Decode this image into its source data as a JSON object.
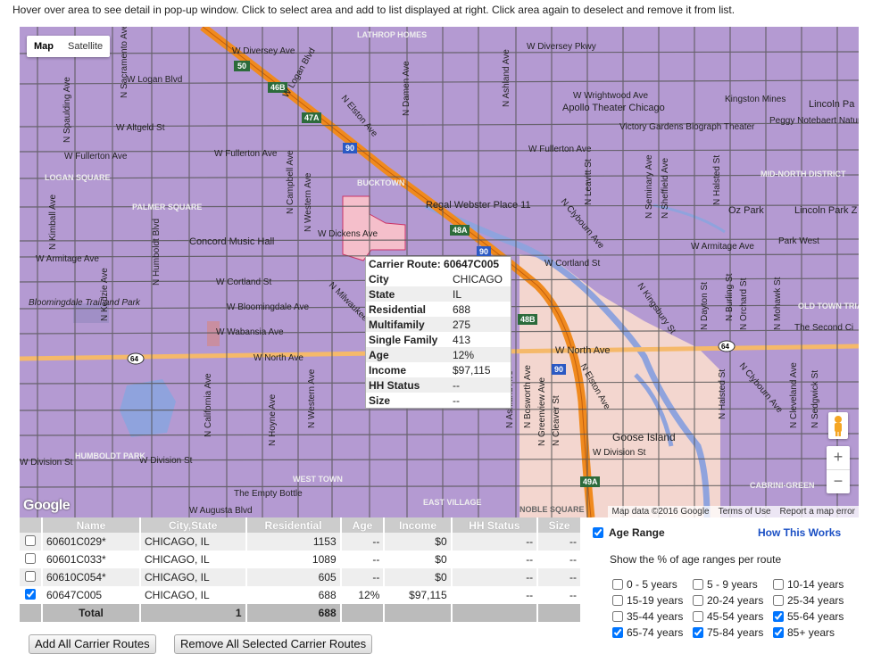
{
  "instruction": "Hover over area to see detail in pop-up window. Click to select area and add to list displayed at right. Click area again to deselect and remove it from list.",
  "map": {
    "toggle": [
      "Map",
      "Satellite"
    ],
    "active_toggle": "Map",
    "google_logo": "Google",
    "attribution": [
      "Map data ©2016 Google",
      "Terms of Use",
      "Report a map error"
    ],
    "labels": {
      "diversey_w": "W Diversey Ave",
      "diversey_pkwy": "W Diversey Pkwy",
      "logan": "W Logan Blvd",
      "altgeld": "W Altgeld St",
      "fullerton_w": "W Fullerton Ave",
      "fullerton_e": "W Fullerton Ave",
      "fullerton_mid": "W Fullerton Ave",
      "wrightwood": "W Wrightwood Ave",
      "apollo": "Apollo Theater Chicago",
      "kingston": "Kingston Mines",
      "victory": "Victory Gardens Biograph Theater",
      "peggy": "Peggy Notebaert Nature Museum",
      "lincoln_park": "Lincoln Pa",
      "logan_square": "LOGAN SQUARE",
      "palmer": "PALMER SQUARE",
      "bucktown": "BUCKTOWN",
      "regal": "Regal Webster Place 11",
      "concord": "Concord Music Hall",
      "dickens": "W Dickens Ave",
      "armitage_w": "W Armitage Ave",
      "armitage_e": "W Armitage Ave",
      "cortland_w": "W Cortland St",
      "cortland_e": "W Cortland St",
      "bloomingdale": "W Bloomingdale Ave",
      "bloomingdale_trail": "Bloomingdale Trail and Park",
      "wabansia": "W Wabansia Ave",
      "north_w": "W North Ave",
      "north_e": "W North Ave",
      "division_w": "W Division St",
      "division_mid": "W Division St",
      "division_e": "W Division St",
      "humboldt": "HUMBOLDT PARK",
      "goose": "Goose Island",
      "empty_bottle": "The Empty Bottle",
      "augusta": "W Augusta Blvd",
      "west_town": "WEST TOWN",
      "east_village": "EAST VILLAGE",
      "noble": "NOBLE SQUARE",
      "mid_north": "MID-NORTH DISTRICT",
      "oz_park": "Oz Park",
      "lincoln_park2": "Lincoln Park Z",
      "park_west": "Park West",
      "old_town": "OLD TOWN TRIANGLE",
      "second_city": "The Second Ci",
      "cabrini": "CABRINI-GREEN",
      "lathrop": "LATHROP HOMES",
      "sr_50": "50",
      "i_46b": "46B",
      "i_47a": "47A",
      "i_90a": "90",
      "i_90b": "90",
      "i_90c": "90",
      "i_48a": "48A",
      "i_48b": "48B",
      "i_49a": "49A",
      "sr_64a": "64",
      "sr_64b": "64",
      "kimball": "N Kimball Ave",
      "spaulding": "N Spaulding Ave",
      "sacramento": "N Sacramento Ave",
      "humboldt_blvd": "N Humboldt Blvd",
      "kedzie": "N Kedzie Ave",
      "california": "N California Ave",
      "campbell": "N Campbell Ave",
      "western": "N Western Ave",
      "damen": "N Damen Ave",
      "ashland": "N Ashland Ave",
      "elston": "N Elston Ave",
      "milwaukee": "N Milwaukee Ave",
      "clybourn": "N Clybourn Ave",
      "halsted": "N Halsted St",
      "sheffield": "N Sheffield Ave",
      "seminary": "N Seminary Ave",
      "kingsbury": "N Kingsbury St",
      "dayton": "N Dayton St",
      "burling": "N Burling St",
      "orchard": "N Orchard St",
      "mohawk": "N Mohawk St",
      "cleveland": "N Cleveland Ave",
      "sedgwick": "N Sedgwick St",
      "hoyne": "N Hoyne Ave",
      "leavitt": "N Leavitt St",
      "bosworth": "N Bosworth Ave",
      "greenview": "N Greenview Ave",
      "cleaver": "N Cleaver St",
      "logan_blvd": "W Logan Blvd"
    }
  },
  "tooltip": {
    "header": "Carrier Route: 60647C005",
    "rows": [
      {
        "k": "City",
        "v": "CHICAGO"
      },
      {
        "k": "State",
        "v": "IL"
      },
      {
        "k": "Residential",
        "v": "688"
      },
      {
        "k": "Multifamily",
        "v": "275"
      },
      {
        "k": "Single Family",
        "v": "413"
      },
      {
        "k": "Age",
        "v": "12%"
      },
      {
        "k": "Income",
        "v": "$97,115"
      },
      {
        "k": "HH Status",
        "v": "--"
      },
      {
        "k": "Size",
        "v": "--"
      }
    ]
  },
  "table": {
    "headers": [
      "Name",
      "City,State",
      "Residential",
      "Age",
      "Income",
      "HH Status",
      "Size"
    ],
    "rows": [
      {
        "checked": false,
        "name": "60601C029*",
        "city": "CHICAGO, IL",
        "res": "1153",
        "age": "--",
        "income": "$0",
        "hh": "--",
        "size": "--"
      },
      {
        "checked": false,
        "name": "60601C033*",
        "city": "CHICAGO, IL",
        "res": "1089",
        "age": "--",
        "income": "$0",
        "hh": "--",
        "size": "--"
      },
      {
        "checked": false,
        "name": "60610C054*",
        "city": "CHICAGO, IL",
        "res": "605",
        "age": "--",
        "income": "$0",
        "hh": "--",
        "size": "--"
      },
      {
        "checked": true,
        "name": "60647C005",
        "city": "CHICAGO, IL",
        "res": "688",
        "age": "12%",
        "income": "$97,115",
        "hh": "--",
        "size": "--"
      }
    ],
    "total_label": "Total",
    "total_count": "1",
    "total_res": "688"
  },
  "buttons": {
    "add_all": "Add All Carrier Routes",
    "remove_all": "Remove All Selected Carrier Routes"
  },
  "age_panel": {
    "title": "Age Range",
    "title_checked": true,
    "link": "How This Works",
    "description": "Show the % of age ranges per route",
    "ranges": [
      {
        "label": "0 - 5 years",
        "checked": false
      },
      {
        "label": "5 - 9 years",
        "checked": false
      },
      {
        "label": "10-14 years",
        "checked": false
      },
      {
        "label": "15-19 years",
        "checked": false
      },
      {
        "label": "20-24 years",
        "checked": false
      },
      {
        "label": "25-34 years",
        "checked": false
      },
      {
        "label": "35-44 years",
        "checked": false
      },
      {
        "label": "45-54 years",
        "checked": false
      },
      {
        "label": "55-64 years",
        "checked": true
      },
      {
        "label": "65-74 years",
        "checked": true
      },
      {
        "label": "75-84 years",
        "checked": true
      },
      {
        "label": "85+ years",
        "checked": true
      }
    ]
  },
  "colors": {
    "route_fill": "#b49ad2",
    "selected_fill": "#f4c9cc",
    "highlight_fill": "#f5cdd2",
    "expressway": "#f08a1e",
    "river": "#8fa3dd",
    "park": "#7db37a",
    "link": "#1a4fc4"
  }
}
